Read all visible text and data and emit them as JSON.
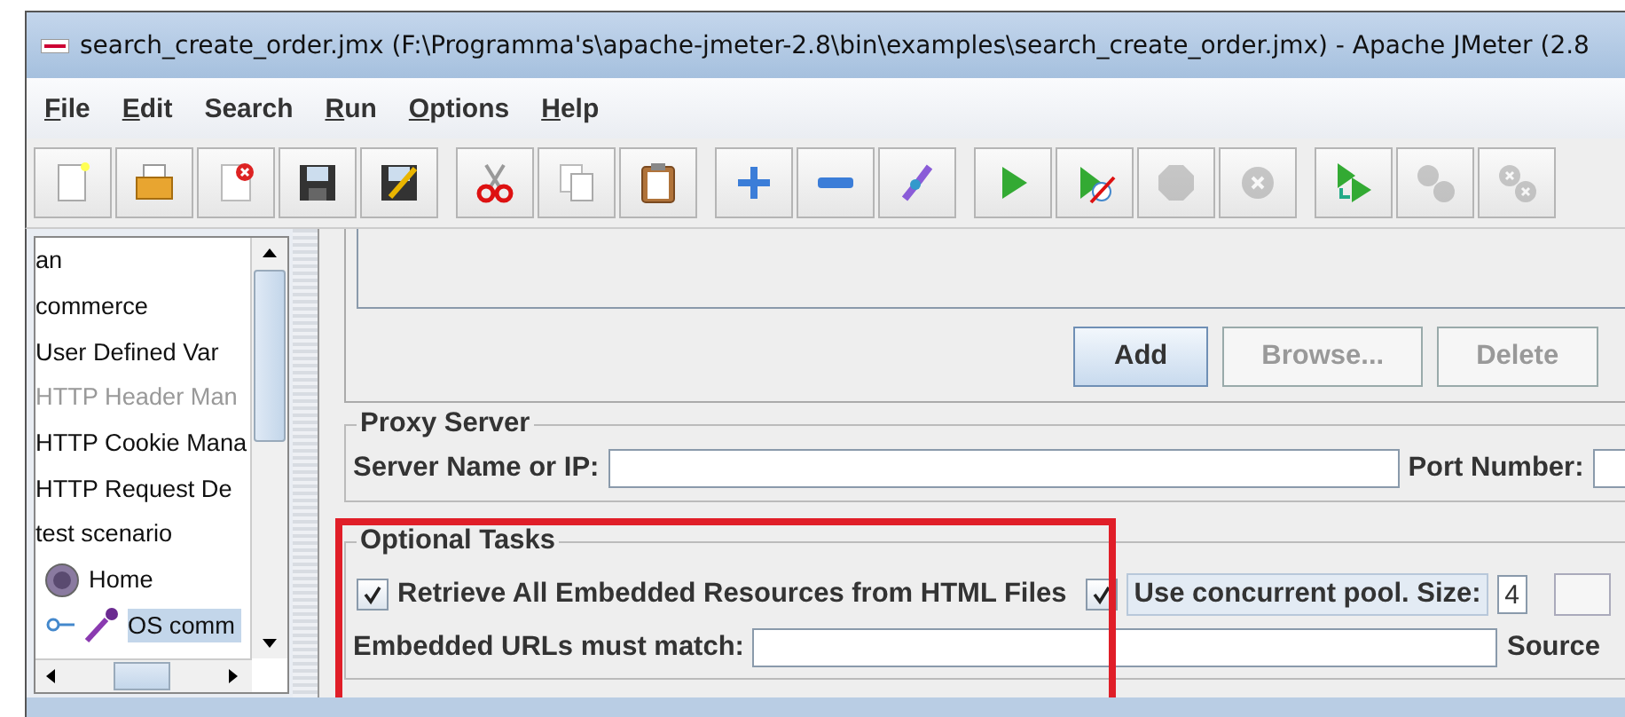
{
  "window": {
    "title": "search_create_order.jmx (F:\\Programma's\\apache-jmeter-2.8\\bin\\examples\\search_create_order.jmx) - Apache JMeter (2.8"
  },
  "menu": [
    {
      "label": "File",
      "mnemonic": true
    },
    {
      "label": "Edit",
      "mnemonic": true
    },
    {
      "label": "Search",
      "mnemonic": false
    },
    {
      "label": "Run",
      "mnemonic": true
    },
    {
      "label": "Options",
      "mnemonic": true
    },
    {
      "label": "Help",
      "mnemonic": true
    }
  ],
  "toolbar": [
    [
      {
        "kind": "new",
        "disabled": false
      },
      {
        "kind": "open",
        "disabled": false
      },
      {
        "kind": "close",
        "disabled": false
      },
      {
        "kind": "save",
        "disabled": false
      },
      {
        "kind": "save-as",
        "disabled": false
      }
    ],
    [
      {
        "kind": "cut",
        "disabled": false
      },
      {
        "kind": "copy",
        "disabled": false
      },
      {
        "kind": "paste",
        "disabled": false
      }
    ],
    [
      {
        "kind": "expand",
        "disabled": false
      },
      {
        "kind": "collapse",
        "disabled": false
      },
      {
        "kind": "toggle",
        "disabled": false
      }
    ],
    [
      {
        "kind": "start",
        "disabled": false
      },
      {
        "kind": "start-no-pause",
        "disabled": false
      },
      {
        "kind": "stop",
        "disabled": true
      },
      {
        "kind": "shutdown",
        "disabled": true
      }
    ],
    [
      {
        "kind": "remote-start",
        "disabled": false
      },
      {
        "kind": "remote-stop",
        "disabled": true
      },
      {
        "kind": "remote-shutdown",
        "disabled": true
      }
    ]
  ],
  "tree": {
    "items": [
      {
        "label": "an",
        "disabled": false,
        "selected": false
      },
      {
        "label": "commerce",
        "disabled": false,
        "selected": false
      },
      {
        "label": "User Defined Var",
        "disabled": false,
        "selected": false
      },
      {
        "label": "HTTP Header Man",
        "disabled": true,
        "selected": false
      },
      {
        "label": "HTTP Cookie Mana",
        "disabled": false,
        "selected": false
      },
      {
        "label": "HTTP Request De",
        "disabled": false,
        "selected": false
      },
      {
        "label": "test scenario",
        "disabled": false,
        "selected": false,
        "children": [
          {
            "label": "Home",
            "kind": "controller",
            "disabled": false,
            "selected": false,
            "children": [
              {
                "label": "OS comm",
                "kind": "sampler",
                "disabled": false,
                "selected": true
              }
            ]
          }
        ]
      }
    ]
  },
  "file_buttons": [
    {
      "label": "Add",
      "disabled": false
    },
    {
      "label": "Browse...",
      "disabled": true
    },
    {
      "label": "Delete",
      "disabled": true
    }
  ],
  "proxy_server": {
    "title": "Proxy Server",
    "server_label": "Server Name or IP:",
    "port_label": "Port Number:"
  },
  "optional_tasks": {
    "title": "Optional Tasks",
    "highlighted": true,
    "retrieve": {
      "label": "Retrieve All Embedded Resources from HTML Files",
      "checked": true
    },
    "pool": {
      "label": "Use concurrent pool. Size:",
      "checked": true,
      "value": "4"
    },
    "match_label": "Embedded URLs must match:",
    "source_label": "Source"
  }
}
